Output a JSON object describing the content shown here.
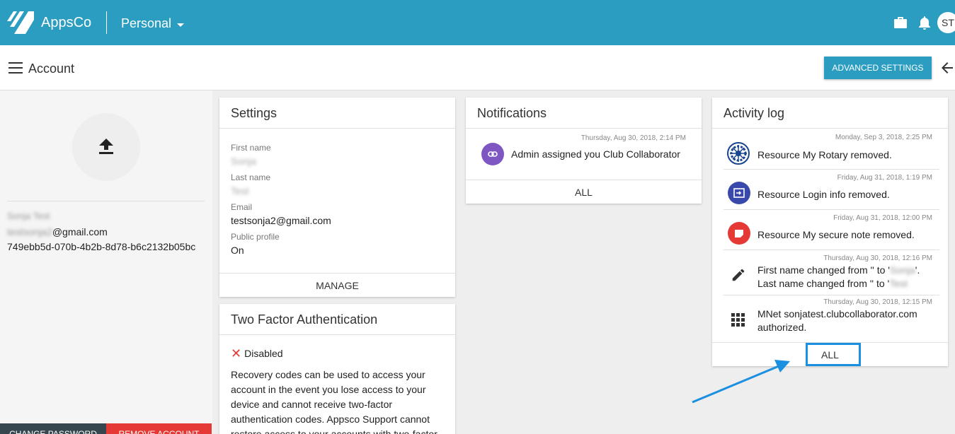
{
  "topbar": {
    "brand": "AppsCo",
    "workspace": "Personal",
    "avatar_initials": "ST",
    "icons": [
      "logo-icon",
      "briefcase-icon",
      "bell-icon"
    ]
  },
  "subbar": {
    "title": "Account",
    "advanced_settings": "ADVANCED SETTINGS"
  },
  "profile": {
    "name": "Sonja Test",
    "email_local": "testsonja2",
    "email_domain": "@gmail.com",
    "id": "749ebb5d-070b-4b2b-8d78-b6c2132b05bc",
    "change_password": "CHANGE PASSWORD",
    "remove_account": "REMOVE ACCOUNT"
  },
  "settings": {
    "title": "Settings",
    "fields": [
      {
        "label": "First name",
        "value": "Sonja"
      },
      {
        "label": "Last name",
        "value": "Test"
      },
      {
        "label": "Email",
        "value": "testsonja2@gmail.com"
      },
      {
        "label": "Public profile",
        "value": "On"
      }
    ],
    "manage": "MANAGE"
  },
  "two_factor": {
    "title": "Two Factor Authentication",
    "status": "Disabled",
    "description": "Recovery codes can be used to access your account in the event you lose access to your device and cannot receive two-factor authentication codes. Appsco Support cannot restore access to your accounts with two-factor"
  },
  "notifications": {
    "title": "Notifications",
    "items": [
      {
        "time": "Thursday, Aug 30, 2018, 2:14 PM",
        "text": "Admin assigned you Club Collaborator"
      }
    ],
    "all": "ALL"
  },
  "activity": {
    "title": "Activity log",
    "items": [
      {
        "time": "Monday, Sep 3, 2018, 2:25 PM",
        "text": "Resource My Rotary removed."
      },
      {
        "time": "Friday, Aug 31, 2018, 1:19 PM",
        "text": "Resource Login info removed."
      },
      {
        "time": "Friday, Aug 31, 2018, 12:00 PM",
        "text": "Resource My secure note removed."
      },
      {
        "time": "Thursday, Aug 30, 2018, 12:16 PM",
        "line1_prefix": "First name changed from '' to '",
        "line1_blur": "Sonja",
        "line1_suffix": "'.",
        "line2_prefix": "Last name changed from '' to '",
        "line2_blur": "Test"
      },
      {
        "time": "Thursday, Aug 30, 2018, 12:15 PM",
        "line1": "MNet sonjatest.clubcollaborator.com",
        "line2": "authorized."
      }
    ],
    "all": "ALL"
  },
  "colors": {
    "primary": "#2a9dc1",
    "danger": "#e53935",
    "dark": "#37474f",
    "highlight": "#1b8fe0"
  }
}
